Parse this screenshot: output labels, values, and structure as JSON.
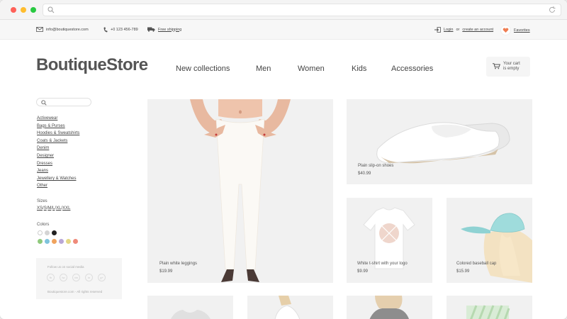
{
  "header": {
    "email": "info@boutiquestore.com",
    "phone": "+0 123 456-789",
    "shipping": "Free shipping",
    "login": "Login",
    "or": "or",
    "create_account": "create an account",
    "favorites": "Favorites"
  },
  "logo": "BoutiqueStore",
  "nav": [
    "New collections",
    "Men",
    "Women",
    "Kids",
    "Accessories"
  ],
  "cart": {
    "line1": "Your cart",
    "line2": "is empty"
  },
  "sidebar": {
    "categories": [
      "Activewear",
      "Bags & Purses",
      "Hoodies & Sweatshirts",
      "Coats & Jackets",
      "Denim",
      "Designer",
      "Dresses",
      "Jeans",
      "Jewellery & Watches",
      "Other"
    ],
    "sizes_label": "Sizes",
    "sizes": [
      "XS",
      "S",
      "M",
      "L",
      "XL",
      "XXL"
    ],
    "size_separator": "/",
    "colors_label": "Colors",
    "colors_row1": [
      "#ffffff",
      "#d4d4d4",
      "#222222"
    ],
    "colors_row2": [
      "#8fc97c",
      "#7ec3dc",
      "#f0a35e",
      "#b9a7d6",
      "#e4d784",
      "#ef8a7a"
    ],
    "social_title": "Follow us on social media",
    "social_icons": [
      "fb",
      "tw",
      "vin",
      "in",
      "g+"
    ],
    "copyright": "Boutiquestore.com - All rights reserved"
  },
  "products": [
    {
      "name": "Plain white leggings",
      "price": "$19.99"
    },
    {
      "name": "Plain slip-on shoes",
      "price": "$40.99"
    },
    {
      "name": "White t-shirt with your logo",
      "price": "$9.99"
    },
    {
      "name": "Colored baseball cap",
      "price": "$15.99"
    }
  ],
  "colors": {
    "accent_heart": "#ef7d52",
    "text": "#444444",
    "card_bg": "#f1f1f1"
  }
}
